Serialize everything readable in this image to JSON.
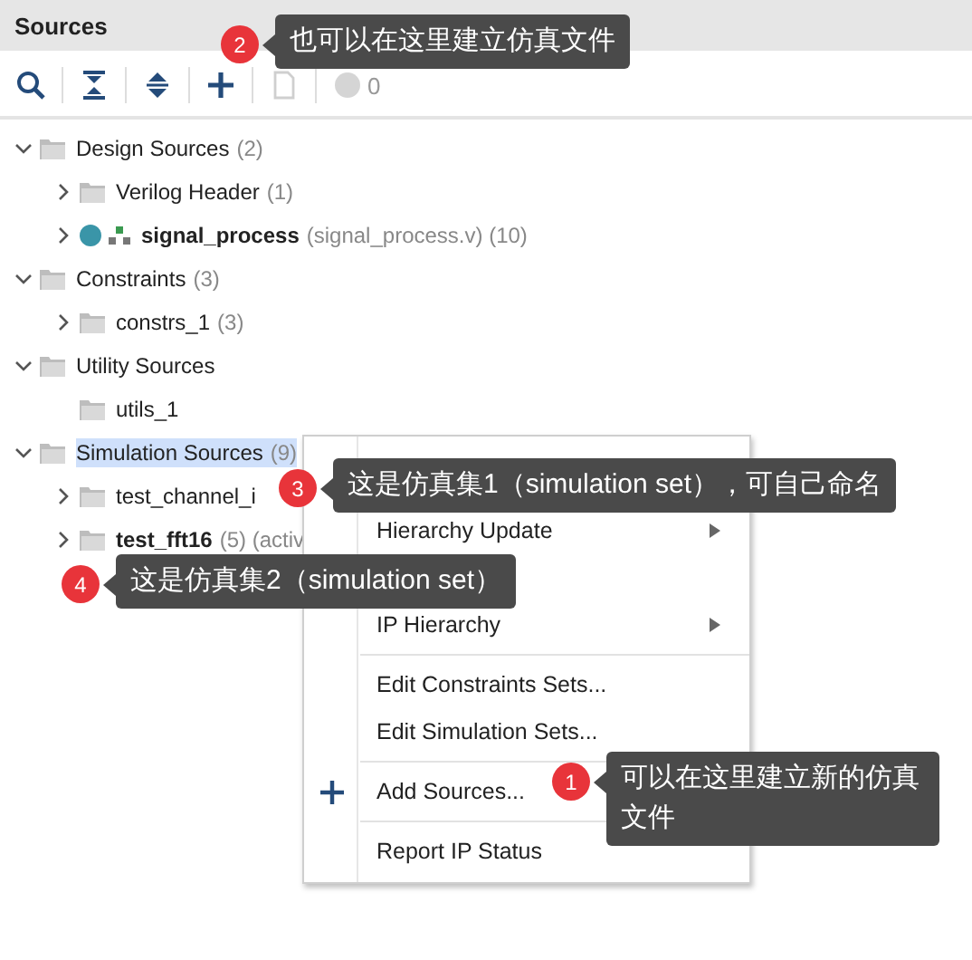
{
  "panel": {
    "title": "Sources"
  },
  "toolbar": {
    "buttons": [
      {
        "kind": "search",
        "disabled": false
      },
      {
        "kind": "collapse",
        "disabled": false
      },
      {
        "kind": "expand",
        "disabled": false
      },
      {
        "kind": "add",
        "disabled": false
      },
      {
        "kind": "file",
        "disabled": true
      }
    ],
    "status_count": "0"
  },
  "tree": [
    {
      "kind": "folder",
      "label": "Design Sources",
      "count": "(2)",
      "bold": false,
      "selected": false,
      "expanded": true,
      "children": [
        {
          "kind": "folder",
          "label": "Verilog Header",
          "count": "(1)",
          "bold": false,
          "selected": false,
          "expanded": false
        },
        {
          "kind": "module",
          "label": "signal_process",
          "count": "(signal_process.v) (10)",
          "bold": true,
          "selected": false,
          "expanded": false
        }
      ]
    },
    {
      "kind": "folder",
      "label": "Constraints",
      "count": "(3)",
      "bold": false,
      "selected": false,
      "expanded": true,
      "children": [
        {
          "kind": "folder",
          "label": "constrs_1",
          "count": "(3)",
          "bold": false,
          "selected": false,
          "expanded": false
        }
      ]
    },
    {
      "kind": "folder",
      "label": "Utility Sources",
      "bold": false,
      "selected": false,
      "expanded": true,
      "children": [
        {
          "kind": "leaf",
          "label": "utils_1",
          "bold": false,
          "selected": false
        }
      ]
    },
    {
      "kind": "folder",
      "label": "Simulation Sources",
      "count": "(9)",
      "bold": false,
      "selected": true,
      "expanded": true,
      "children": [
        {
          "kind": "folder",
          "label": "test_channel_i",
          "bold": false,
          "selected": false,
          "expanded": false
        },
        {
          "kind": "folder",
          "label": "test_fft16",
          "count": "(5) (activ",
          "bold": true,
          "selected": false,
          "expanded": false
        }
      ]
    }
  ],
  "context_menu": {
    "items": [
      {
        "kind": "blank"
      },
      {
        "kind": "submenu",
        "label": "Hierarchy Update"
      },
      {
        "kind": "blank"
      },
      {
        "kind": "submenu",
        "label": "IP Hierarchy"
      },
      {
        "kind": "separator"
      },
      {
        "kind": "item",
        "label": "Edit Constraints Sets..."
      },
      {
        "kind": "item",
        "label": "Edit Simulation Sets..."
      },
      {
        "kind": "separator"
      },
      {
        "kind": "add",
        "label": "Add Sources..."
      },
      {
        "kind": "separator"
      },
      {
        "kind": "item",
        "label": "Report IP Status"
      }
    ]
  },
  "callouts": [
    {
      "number": "2",
      "text": "也可以在这里建立仿真文件"
    },
    {
      "number": "3",
      "text": "这是仿真集1（simulation set），可自己命名"
    },
    {
      "number": "4",
      "text": "这是仿真集2（simulation set）"
    },
    {
      "number": "1",
      "text": "可以在这里建立新的仿真文件"
    }
  ]
}
